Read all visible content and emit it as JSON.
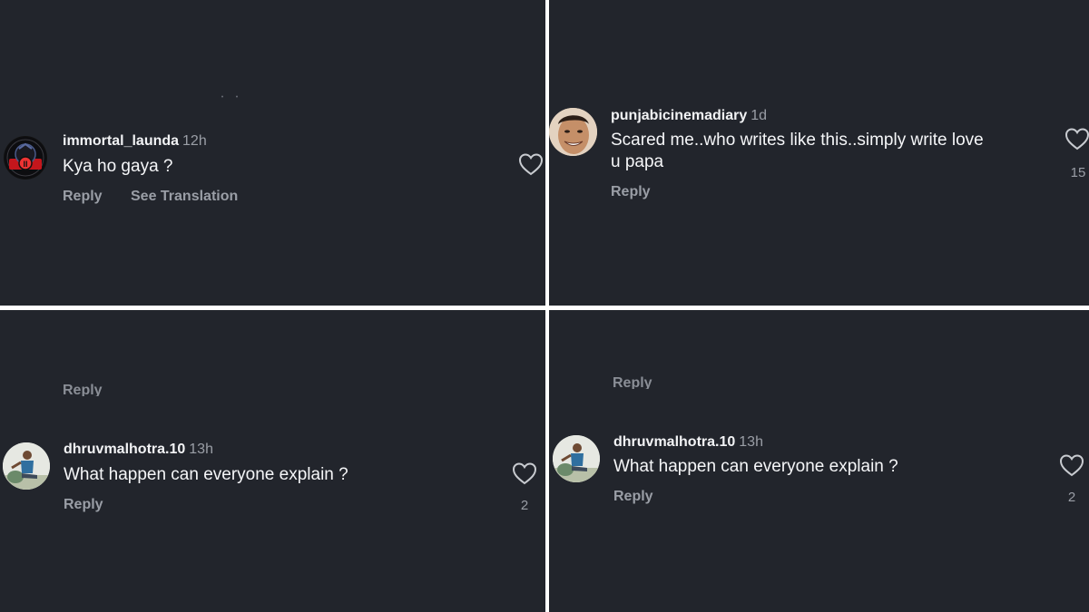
{
  "panels": [
    {
      "username": "immortal_launda",
      "time": "12h",
      "text": "Kya ho gaya ?",
      "reply": "Reply",
      "translate": "See Translation",
      "avatar_icon": "red-logo-avatar-icon"
    },
    {
      "username": "punjabicinemadiary",
      "time": "1d",
      "text_line1": "Scared me..who writes like this..simply write love",
      "text_line2": "u papa",
      "reply": "Reply",
      "likes": "15",
      "avatar_icon": "smiling-man-avatar-icon"
    },
    {
      "prev_reply": "Reply",
      "username": "dhruvmalhotra.10",
      "time": "13h",
      "text": "What happen can everyone explain ?",
      "reply": "Reply",
      "likes": "2",
      "avatar_icon": "seated-man-avatar-icon"
    },
    {
      "prev_reply": "Reply",
      "username": "dhruvmalhotra.10",
      "time": "13h",
      "text": "What happen can everyone explain ?",
      "reply": "Reply",
      "likes": "2",
      "avatar_icon": "seated-man-avatar-icon"
    }
  ],
  "colors": {
    "background": "#22252c",
    "divider": "#ffffff",
    "primary_text": "#f5f6f8",
    "secondary_text": "#9a9ea6"
  }
}
